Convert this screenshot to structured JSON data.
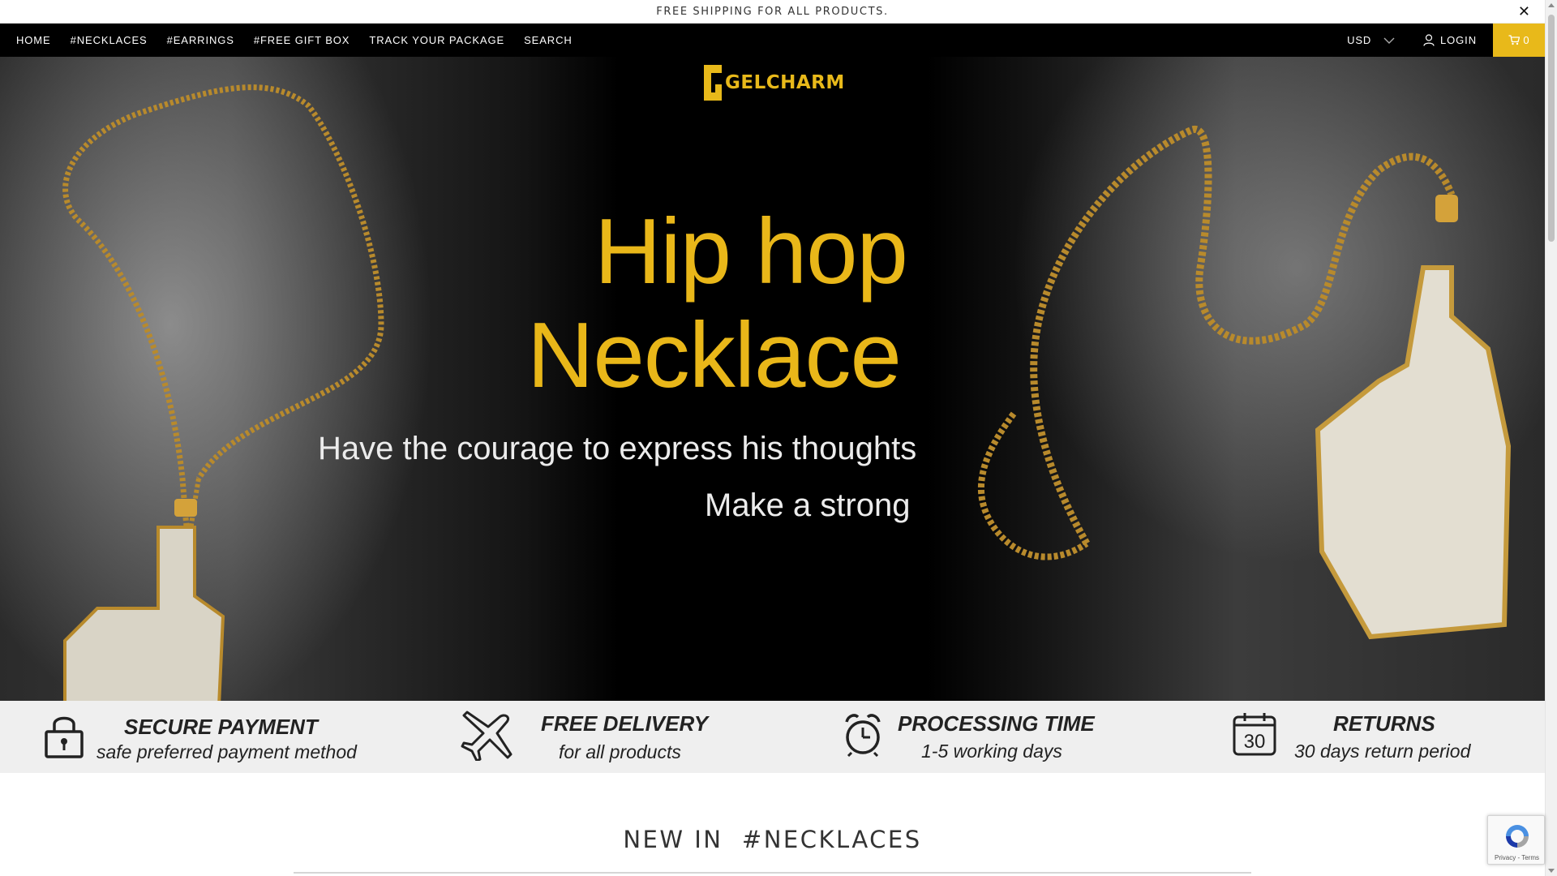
{
  "announcement": {
    "text": "FREE SHIPPING FOR ALL PRODUCTS.",
    "close_glyph": "✕"
  },
  "nav": {
    "items": [
      {
        "label": "HOME"
      },
      {
        "label": "#NECKLACES"
      },
      {
        "label": "#EARRINGS"
      },
      {
        "label": "#FREE GIFT BOX"
      },
      {
        "label": "TRACK YOUR PACKAGE"
      },
      {
        "label": "SEARCH"
      }
    ],
    "currency": "USD",
    "login_label": "LOGIN",
    "cart_count": "0"
  },
  "brand": {
    "name": "GELCHARM",
    "accent_color": "#e8b91a"
  },
  "hero": {
    "title_line1": "Hip hop",
    "title_line2": "Necklace",
    "subtitle_line1": "Have the courage to express his thoughts",
    "subtitle_line2": "Make a strong"
  },
  "features": [
    {
      "icon": "lock-icon",
      "title": "SECURE PAYMENT",
      "subtitle": "safe preferred payment method"
    },
    {
      "icon": "airplane-icon",
      "title": "FREE DELIVERY",
      "subtitle": "for all products"
    },
    {
      "icon": "alarm-clock-icon",
      "title": "PROCESSING TIME",
      "subtitle": "1-5 working days"
    },
    {
      "icon": "calendar-icon",
      "title": "RETURNS",
      "subtitle": "30 days return period",
      "icon_number": "30"
    }
  ],
  "section": {
    "title": "NEW IN  #NECKLACES"
  },
  "recaptcha": {
    "footer": "Privacy - Terms"
  }
}
